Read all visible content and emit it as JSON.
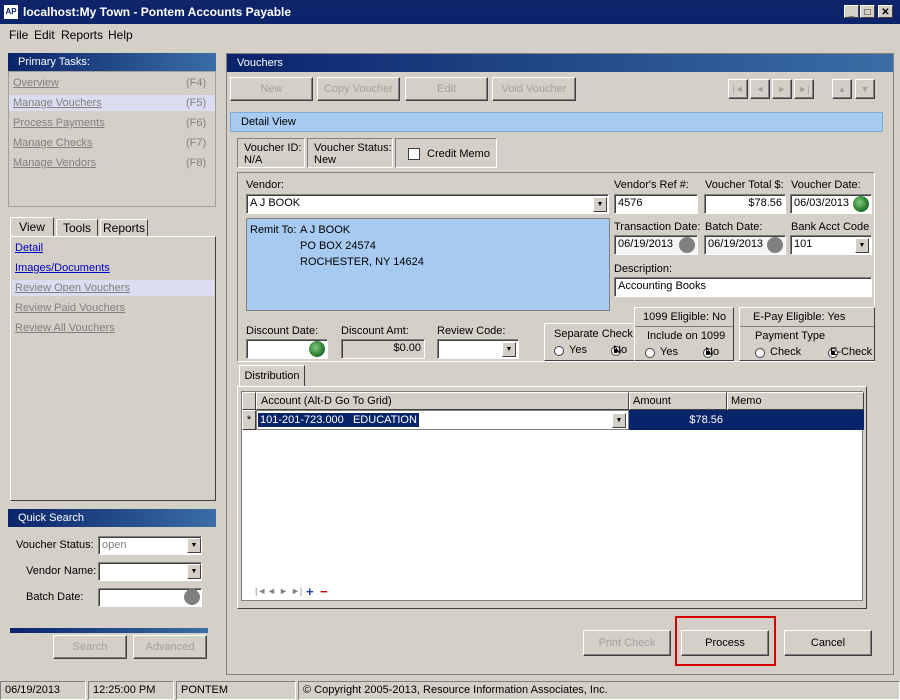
{
  "window": {
    "app_icon": "AP",
    "title": "localhost:My Town - Pontem Accounts Payable",
    "controls": [
      "minimize-icon",
      "maximize-icon",
      "close-icon"
    ]
  },
  "menu": {
    "file": "File",
    "edit": "Edit",
    "reports": "Reports",
    "help": "Help"
  },
  "primary_tasks": {
    "title": "Primary Tasks:",
    "items": [
      {
        "label": "Overview",
        "key": "(F4)"
      },
      {
        "label": "Manage Vouchers",
        "key": "(F5)"
      },
      {
        "label": "Process Payments",
        "key": "(F6)"
      },
      {
        "label": "Manage Checks",
        "key": "(F7)"
      },
      {
        "label": "Manage Vendors",
        "key": "(F8)"
      }
    ]
  },
  "side_tabs": {
    "tabs": [
      "View",
      "Tools",
      "Reports"
    ],
    "links": [
      "Detail",
      "Images/Documents",
      "Review Open Vouchers",
      "Review Paid Vouchers",
      "Review All Vouchers"
    ]
  },
  "quick_search": {
    "title": "Quick Search",
    "voucher_status_label": "Voucher Status:",
    "voucher_status_value": "open",
    "vendor_name_label": "Vendor Name:",
    "batch_date_label": "Batch Date:",
    "search_button": "Search",
    "advanced_button": "Advanced"
  },
  "vouchers": {
    "title": "Vouchers",
    "toolbar": {
      "new": "New",
      "copy": "Copy Voucher",
      "edit": "Edit",
      "void": "Void Voucher"
    },
    "nav_icons": [
      "first-record-icon",
      "prev-record-icon",
      "next-record-icon",
      "last-record-icon",
      "up-icon",
      "down-icon"
    ],
    "detail_view_label": "Detail View",
    "voucher_id_label": "Voucher ID:",
    "voucher_id_value": "N/A",
    "voucher_status_label": "Voucher Status:",
    "voucher_status_value": "New",
    "credit_memo_label": "Credit Memo"
  },
  "form": {
    "vendor_label": "Vendor:",
    "vendor_value": "A J BOOK",
    "vendor_ref_label": "Vendor's Ref #:",
    "vendor_ref_value": "4576",
    "voucher_total_label": "Voucher Total $:",
    "voucher_total_value": "$78.56",
    "voucher_date_label": "Voucher Date:",
    "voucher_date_value": "06/03/2013",
    "remit_label": "Remit To:",
    "remit_lines": [
      "A J BOOK",
      "PO BOX 24574",
      "ROCHESTER, NY 14624"
    ],
    "transaction_date_label": "Transaction Date:",
    "transaction_date_value": "06/19/2013",
    "batch_date_label": "Batch Date:",
    "batch_date_value": "06/19/2013",
    "bank_acct_label": "Bank Acct Code",
    "bank_acct_value": "101",
    "description_label": "Description:",
    "description_value": "Accounting Books",
    "discount_date_label": "Discount Date:",
    "discount_amt_label": "Discount Amt:",
    "discount_amt_value": "$0.00",
    "review_code_label": "Review Code:",
    "separate_check_label": "Separate Check",
    "yes_label": "Yes",
    "no_label": "No",
    "eligible_1099_label": "1099 Eligible: No",
    "include_1099_label": "Include on 1099",
    "epay_label": "E-Pay Eligible: Yes",
    "payment_type_label": "Payment Type",
    "check_label": "Check",
    "echeck_label": "E-Check"
  },
  "distribution": {
    "tab_label": "Distribution",
    "columns": [
      "Account (Alt-D Go To Grid)",
      "Amount",
      "Memo"
    ],
    "rows": [
      {
        "marker": "*",
        "account": "101-201-723.000   EDUCATION",
        "amount": "$78.56",
        "memo": ""
      }
    ]
  },
  "actions": {
    "print_check": "Print Check",
    "process": "Process",
    "cancel": "Cancel"
  },
  "statusbar": {
    "date": "06/19/2013",
    "time": "12:25:00 PM",
    "user": "PONTEM",
    "copyright": "© Copyright 2005-2013, Resource Information Associates, Inc."
  },
  "colors": {
    "title_blue": "#0a246a",
    "selection_blue": "#0a246a",
    "remit_blue": "#a6caf0",
    "highlight_red": "#d40000"
  }
}
